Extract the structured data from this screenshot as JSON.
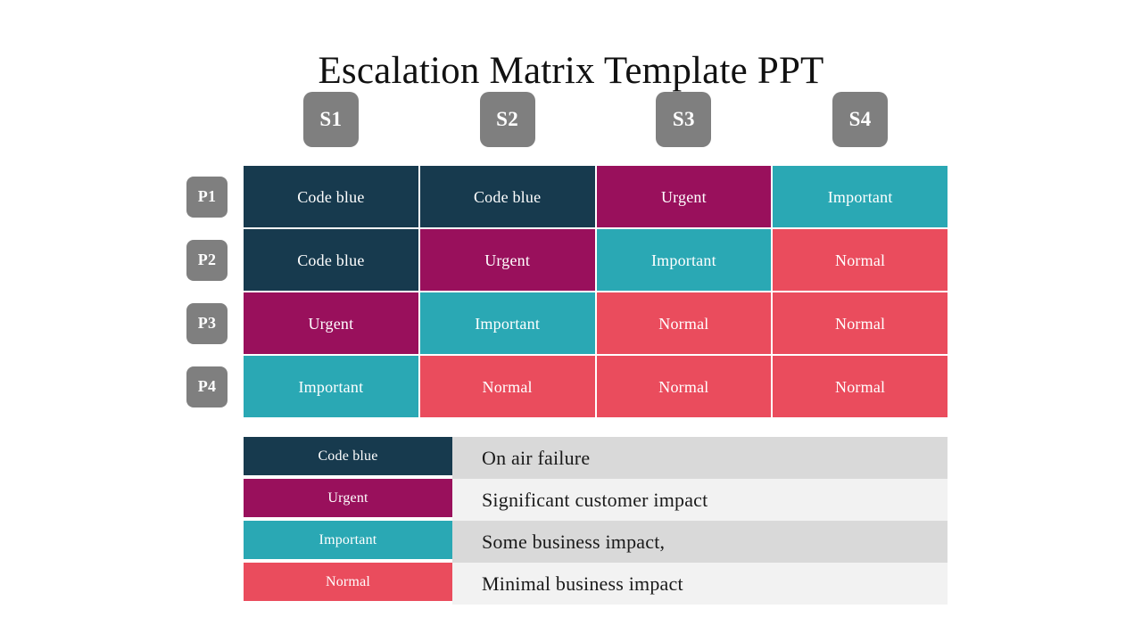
{
  "title": "Escalation Matrix Template PPT",
  "colors": {
    "code_blue": "#173a4e",
    "urgent": "#99105c",
    "important": "#2aa8b4",
    "normal": "#ea4c5d",
    "badge_gray": "#7f7f7f",
    "legend_band_dark": "#d9d9d9",
    "legend_band_light": "#f2f2f2",
    "text_light": "#ffffff",
    "text_dark": "#1a1a1a",
    "background": "#ffffff"
  },
  "column_headers": [
    {
      "label": "S1"
    },
    {
      "label": "S2"
    },
    {
      "label": "S3"
    },
    {
      "label": "S4"
    }
  ],
  "row_headers": [
    {
      "label": "P1"
    },
    {
      "label": "P2"
    },
    {
      "label": "P3"
    },
    {
      "label": "P4"
    }
  ],
  "matrix": [
    {
      "row_label": "P1",
      "cells": [
        {
          "label": "Code blue",
          "color": "#173a4e"
        },
        {
          "label": "Code blue",
          "color": "#173a4e"
        },
        {
          "label": "Urgent",
          "color": "#99105c"
        },
        {
          "label": "Important",
          "color": "#2aa8b4"
        }
      ]
    },
    {
      "row_label": "P2",
      "cells": [
        {
          "label": "Code blue",
          "color": "#173a4e"
        },
        {
          "label": "Urgent",
          "color": "#99105c"
        },
        {
          "label": "Important",
          "color": "#2aa8b4"
        },
        {
          "label": "Normal",
          "color": "#ea4c5d"
        }
      ]
    },
    {
      "row_label": "P3",
      "cells": [
        {
          "label": "Urgent",
          "color": "#99105c"
        },
        {
          "label": "Important",
          "color": "#2aa8b4"
        },
        {
          "label": "Normal",
          "color": "#ea4c5d"
        },
        {
          "label": "Normal",
          "color": "#ea4c5d"
        }
      ]
    },
    {
      "row_label": "P4",
      "cells": [
        {
          "label": "Important",
          "color": "#2aa8b4"
        },
        {
          "label": "Normal",
          "color": "#ea4c5d"
        },
        {
          "label": "Normal",
          "color": "#ea4c5d"
        },
        {
          "label": "Normal",
          "color": "#ea4c5d"
        }
      ]
    }
  ],
  "legend": [
    {
      "label": "Code blue",
      "description": "On air failure",
      "color": "#173a4e",
      "band": "#d9d9d9"
    },
    {
      "label": "Urgent",
      "description": "Significant customer impact",
      "color": "#99105c",
      "band": "#f2f2f2"
    },
    {
      "label": "Important",
      "description": "Some business impact,",
      "color": "#2aa8b4",
      "band": "#d9d9d9"
    },
    {
      "label": "Normal",
      "description": "Minimal business impact",
      "color": "#ea4c5d",
      "band": "#f2f2f2"
    }
  ]
}
